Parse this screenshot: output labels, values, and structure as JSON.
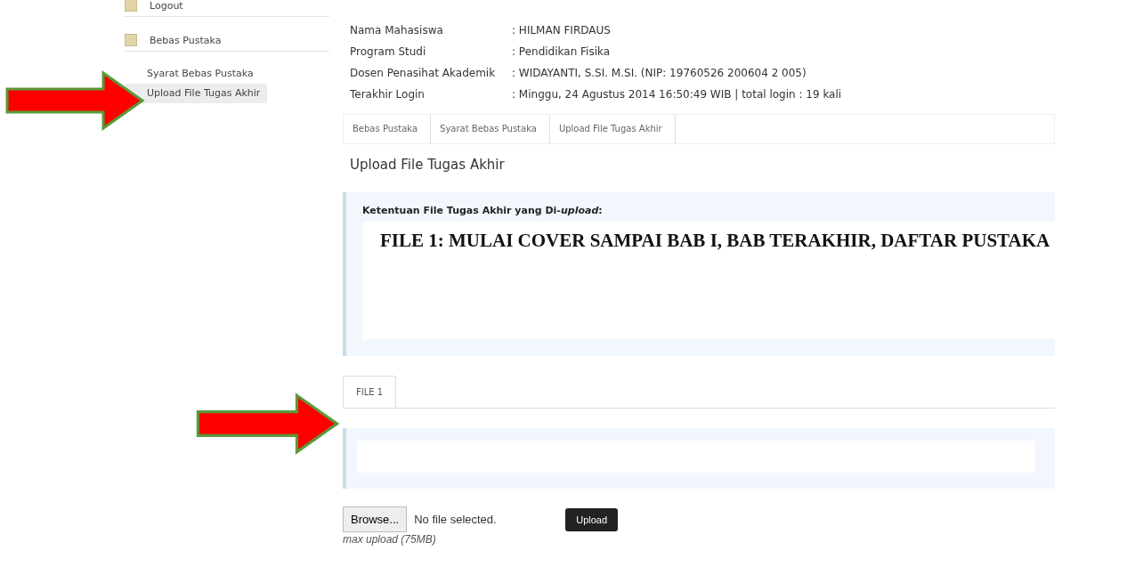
{
  "sidebar": {
    "items": [
      {
        "label": "Logout",
        "kind": "header",
        "selected": false
      },
      {
        "label": "Bebas Pustaka",
        "kind": "header",
        "selected": false
      },
      {
        "label": "Syarat Bebas Pustaka",
        "kind": "link",
        "selected": false
      },
      {
        "label": "Upload File Tugas Akhir",
        "kind": "link",
        "selected": true
      }
    ]
  },
  "profile": {
    "rows": [
      {
        "label": "Nama Mahasiswa",
        "value": ": HILMAN FIRDAUS"
      },
      {
        "label": "Program Studi",
        "value": ": Pendidikan Fisika"
      },
      {
        "label": "Dosen Penasihat Akademik",
        "value": ": WIDAYANTI, S.SI. M.SI. (NIP: 19760526 200604 2 005)"
      },
      {
        "label": "Terakhir Login",
        "value": ": Minggu, 24 Agustus 2014 16:50:49 WIB | total login : 19 kali"
      }
    ]
  },
  "breadcrumb": [
    "Bebas Pustaka",
    "Syarat Bebas Pustaka",
    "Upload File Tugas Akhir"
  ],
  "page_title": "Upload File Tugas Akhir",
  "notice": {
    "heading": "Ketentuan File Tugas Akhir yang Di-*upload*:",
    "note": "FILE 1: MULAI COVER SAMPAI BAB I, BAB TERAKHIR, DAFTAR PUSTAKA"
  },
  "tabs": [
    {
      "label": "FILE 1",
      "selected": true
    }
  ],
  "upload": {
    "browse": "Browse...",
    "status": "No file selected.",
    "button": "Upload",
    "hint": "max upload (75MB)"
  }
}
